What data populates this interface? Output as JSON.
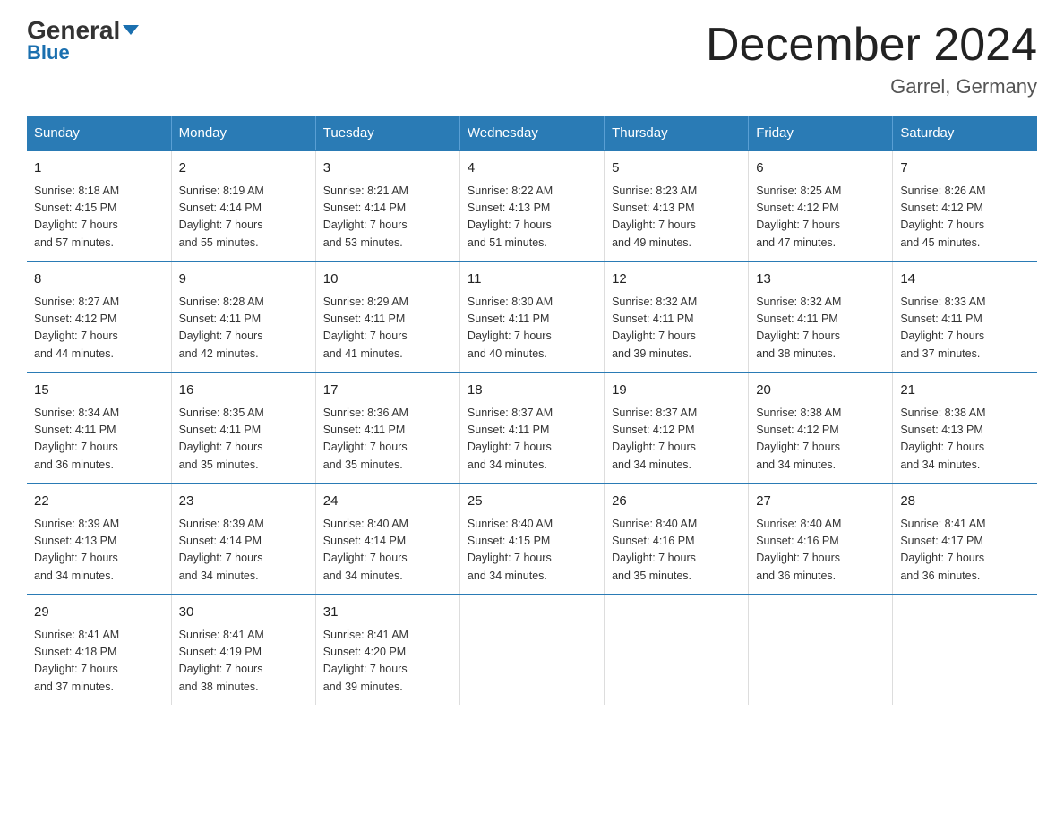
{
  "logo": {
    "part1": "General",
    "part2": "Blue"
  },
  "header": {
    "title": "December 2024",
    "location": "Garrel, Germany"
  },
  "weekdays": [
    "Sunday",
    "Monday",
    "Tuesday",
    "Wednesday",
    "Thursday",
    "Friday",
    "Saturday"
  ],
  "weeks": [
    [
      {
        "day": "1",
        "sunrise": "8:18 AM",
        "sunset": "4:15 PM",
        "daylight": "7 hours and 57 minutes."
      },
      {
        "day": "2",
        "sunrise": "8:19 AM",
        "sunset": "4:14 PM",
        "daylight": "7 hours and 55 minutes."
      },
      {
        "day": "3",
        "sunrise": "8:21 AM",
        "sunset": "4:14 PM",
        "daylight": "7 hours and 53 minutes."
      },
      {
        "day": "4",
        "sunrise": "8:22 AM",
        "sunset": "4:13 PM",
        "daylight": "7 hours and 51 minutes."
      },
      {
        "day": "5",
        "sunrise": "8:23 AM",
        "sunset": "4:13 PM",
        "daylight": "7 hours and 49 minutes."
      },
      {
        "day": "6",
        "sunrise": "8:25 AM",
        "sunset": "4:12 PM",
        "daylight": "7 hours and 47 minutes."
      },
      {
        "day": "7",
        "sunrise": "8:26 AM",
        "sunset": "4:12 PM",
        "daylight": "7 hours and 45 minutes."
      }
    ],
    [
      {
        "day": "8",
        "sunrise": "8:27 AM",
        "sunset": "4:12 PM",
        "daylight": "7 hours and 44 minutes."
      },
      {
        "day": "9",
        "sunrise": "8:28 AM",
        "sunset": "4:11 PM",
        "daylight": "7 hours and 42 minutes."
      },
      {
        "day": "10",
        "sunrise": "8:29 AM",
        "sunset": "4:11 PM",
        "daylight": "7 hours and 41 minutes."
      },
      {
        "day": "11",
        "sunrise": "8:30 AM",
        "sunset": "4:11 PM",
        "daylight": "7 hours and 40 minutes."
      },
      {
        "day": "12",
        "sunrise": "8:32 AM",
        "sunset": "4:11 PM",
        "daylight": "7 hours and 39 minutes."
      },
      {
        "day": "13",
        "sunrise": "8:32 AM",
        "sunset": "4:11 PM",
        "daylight": "7 hours and 38 minutes."
      },
      {
        "day": "14",
        "sunrise": "8:33 AM",
        "sunset": "4:11 PM",
        "daylight": "7 hours and 37 minutes."
      }
    ],
    [
      {
        "day": "15",
        "sunrise": "8:34 AM",
        "sunset": "4:11 PM",
        "daylight": "7 hours and 36 minutes."
      },
      {
        "day": "16",
        "sunrise": "8:35 AM",
        "sunset": "4:11 PM",
        "daylight": "7 hours and 35 minutes."
      },
      {
        "day": "17",
        "sunrise": "8:36 AM",
        "sunset": "4:11 PM",
        "daylight": "7 hours and 35 minutes."
      },
      {
        "day": "18",
        "sunrise": "8:37 AM",
        "sunset": "4:11 PM",
        "daylight": "7 hours and 34 minutes."
      },
      {
        "day": "19",
        "sunrise": "8:37 AM",
        "sunset": "4:12 PM",
        "daylight": "7 hours and 34 minutes."
      },
      {
        "day": "20",
        "sunrise": "8:38 AM",
        "sunset": "4:12 PM",
        "daylight": "7 hours and 34 minutes."
      },
      {
        "day": "21",
        "sunrise": "8:38 AM",
        "sunset": "4:13 PM",
        "daylight": "7 hours and 34 minutes."
      }
    ],
    [
      {
        "day": "22",
        "sunrise": "8:39 AM",
        "sunset": "4:13 PM",
        "daylight": "7 hours and 34 minutes."
      },
      {
        "day": "23",
        "sunrise": "8:39 AM",
        "sunset": "4:14 PM",
        "daylight": "7 hours and 34 minutes."
      },
      {
        "day": "24",
        "sunrise": "8:40 AM",
        "sunset": "4:14 PM",
        "daylight": "7 hours and 34 minutes."
      },
      {
        "day": "25",
        "sunrise": "8:40 AM",
        "sunset": "4:15 PM",
        "daylight": "7 hours and 34 minutes."
      },
      {
        "day": "26",
        "sunrise": "8:40 AM",
        "sunset": "4:16 PM",
        "daylight": "7 hours and 35 minutes."
      },
      {
        "day": "27",
        "sunrise": "8:40 AM",
        "sunset": "4:16 PM",
        "daylight": "7 hours and 36 minutes."
      },
      {
        "day": "28",
        "sunrise": "8:41 AM",
        "sunset": "4:17 PM",
        "daylight": "7 hours and 36 minutes."
      }
    ],
    [
      {
        "day": "29",
        "sunrise": "8:41 AM",
        "sunset": "4:18 PM",
        "daylight": "7 hours and 37 minutes."
      },
      {
        "day": "30",
        "sunrise": "8:41 AM",
        "sunset": "4:19 PM",
        "daylight": "7 hours and 38 minutes."
      },
      {
        "day": "31",
        "sunrise": "8:41 AM",
        "sunset": "4:20 PM",
        "daylight": "7 hours and 39 minutes."
      },
      null,
      null,
      null,
      null
    ]
  ],
  "labels": {
    "sunrise": "Sunrise:",
    "sunset": "Sunset:",
    "daylight": "Daylight: 7 hours"
  }
}
